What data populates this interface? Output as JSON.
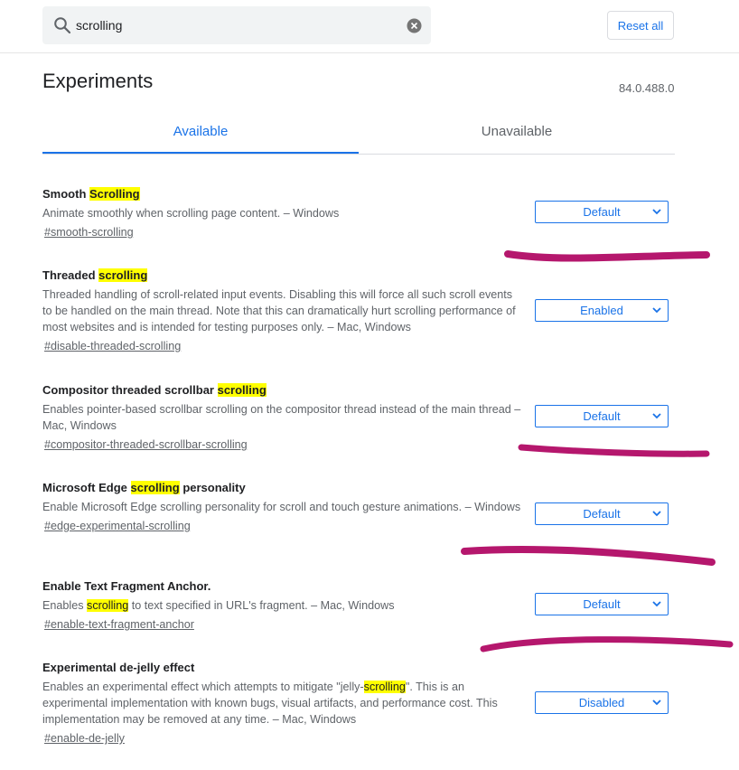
{
  "search": {
    "value": "scrolling"
  },
  "header": {
    "reset_label": "Reset all"
  },
  "page": {
    "title": "Experiments",
    "version": "84.0.488.0"
  },
  "tabs": {
    "available": "Available",
    "unavailable": "Unavailable"
  },
  "experiments": [
    {
      "name_before": "Smooth ",
      "name_highlight": "Scrolling",
      "name_after": "",
      "desc_before": "Animate smoothly when scrolling page content. – Windows",
      "desc_highlight": "",
      "desc_after": "",
      "link": "#smooth-scrolling",
      "value": "Default"
    },
    {
      "name_before": "Threaded ",
      "name_highlight": "scrolling",
      "name_after": "",
      "desc_before": "Threaded handling of scroll-related input events. Disabling this will force all such scroll events to be handled on the main thread. Note that this can dramatically hurt scrolling performance of most websites and is intended for testing purposes only. – Mac, Windows",
      "desc_highlight": "",
      "desc_after": "",
      "link": "#disable-threaded-scrolling",
      "value": "Enabled"
    },
    {
      "name_before": "Compositor threaded scrollbar ",
      "name_highlight": "scrolling",
      "name_after": "",
      "desc_before": "Enables pointer-based scrollbar scrolling on the compositor thread instead of the main thread – Mac, Windows",
      "desc_highlight": "",
      "desc_after": "",
      "link": "#compositor-threaded-scrollbar-scrolling",
      "value": "Default"
    },
    {
      "name_before": "Microsoft Edge ",
      "name_highlight": "scrolling",
      "name_after": " personality",
      "desc_before": "Enable Microsoft Edge scrolling personality for scroll and touch gesture animations. – Windows",
      "desc_highlight": "",
      "desc_after": "",
      "link": "#edge-experimental-scrolling",
      "value": "Default"
    },
    {
      "name_before": "Enable Text Fragment Anchor.",
      "name_highlight": "",
      "name_after": "",
      "desc_before": "Enables ",
      "desc_highlight": "scrolling",
      "desc_after": " to text specified in URL's fragment. – Mac, Windows",
      "link": "#enable-text-fragment-anchor",
      "value": "Default"
    },
    {
      "name_before": "Experimental de-jelly effect",
      "name_highlight": "",
      "name_after": "",
      "desc_before": "Enables an experimental effect which attempts to mitigate \"jelly-",
      "desc_highlight": "scrolling",
      "desc_after": "\". This is an experimental implementation with known bugs, visual artifacts, and performance cost. This implementation may be removed at any time. – Mac, Windows",
      "link": "#enable-de-jelly",
      "value": "Disabled"
    }
  ],
  "colors": {
    "accent": "#1a73e8",
    "highlight": "#ffff00",
    "annotation": "#b5176d"
  },
  "icons": {
    "search": "search-icon",
    "clear": "clear-icon",
    "dropdown": "chevron-down-icon"
  }
}
